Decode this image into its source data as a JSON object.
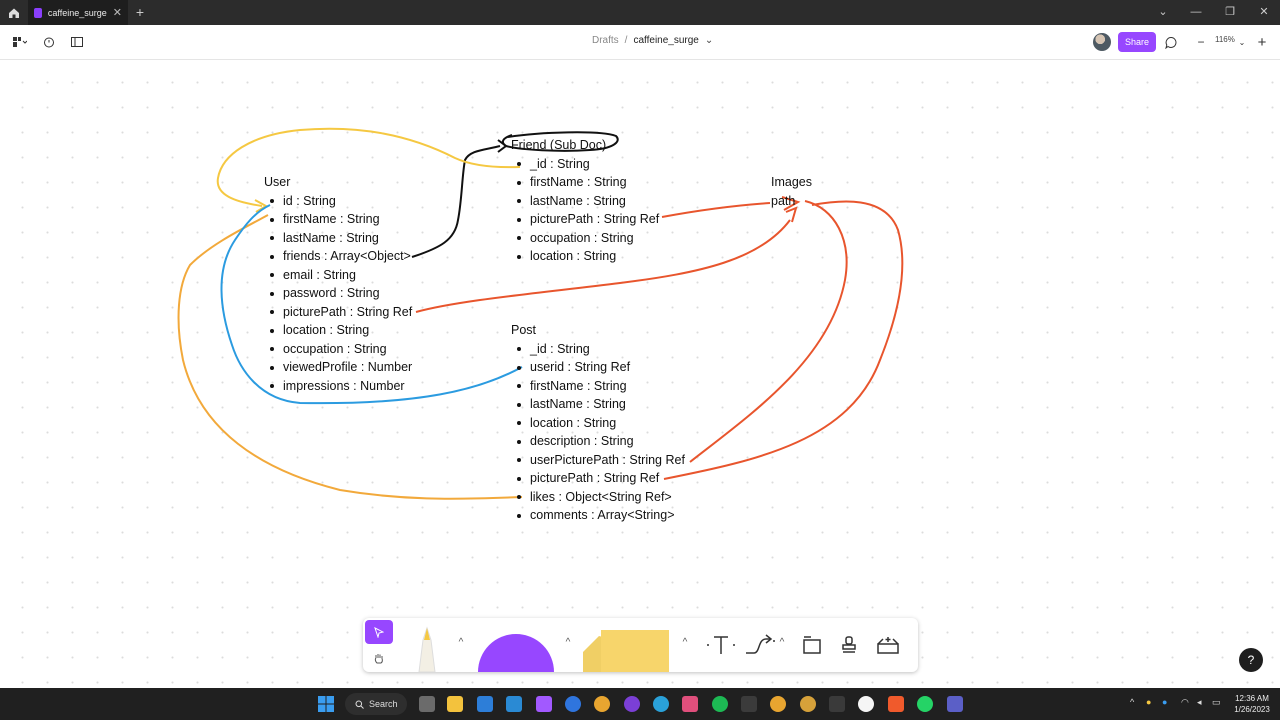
{
  "browser": {
    "tab_title": "caffeine_surge",
    "tab_close": "✕",
    "new_tab": "+"
  },
  "topbar": {
    "breadcrumb_folder": "Drafts",
    "breadcrumb_sep": "/",
    "file_name": "caffeine_surge",
    "share_label": "Share",
    "zoom_label": "116%",
    "zoom_out": "−",
    "zoom_in": "+"
  },
  "diagram": {
    "user": {
      "title": "User",
      "fields": [
        "id : String",
        "firstName : String",
        "lastName : String",
        "friends : Array<Object>",
        "email : String",
        "password : String",
        "picturePath : String Ref",
        "location : String",
        "occupation : String",
        "viewedProfile : Number",
        "impressions : Number"
      ]
    },
    "friend": {
      "title": "Friend (Sub Doc)",
      "fields": [
        "_id : String",
        "firstName : String",
        "lastName : String",
        "picturePath : String Ref",
        "occupation : String",
        "location : String"
      ]
    },
    "images": {
      "title": "Images",
      "fields": [
        "path"
      ]
    },
    "post": {
      "title": "Post",
      "fields": [
        "_id : String",
        "userid : String Ref",
        "firstName : String",
        "lastName : String",
        "location : String",
        "description : String",
        "userPicturePath : String Ref",
        "picturePath : String Ref",
        "likes : Object<String Ref>",
        "comments : Array<String>"
      ]
    },
    "colors": {
      "friend_link": "#f5c842",
      "likes_link": "#f2a93b",
      "userid_link": "#2b9be0",
      "picture_link": "#e8552d",
      "sub_doc_link": "#111111"
    }
  },
  "dock": {
    "colors": {
      "select_active": "#9747ff",
      "shape": "#9747ff",
      "sticky": "#f7d56b"
    }
  },
  "help_label": "?",
  "taskbar": {
    "search_label": "Search",
    "time": "12:36 AM",
    "date": "1/26/2023"
  }
}
